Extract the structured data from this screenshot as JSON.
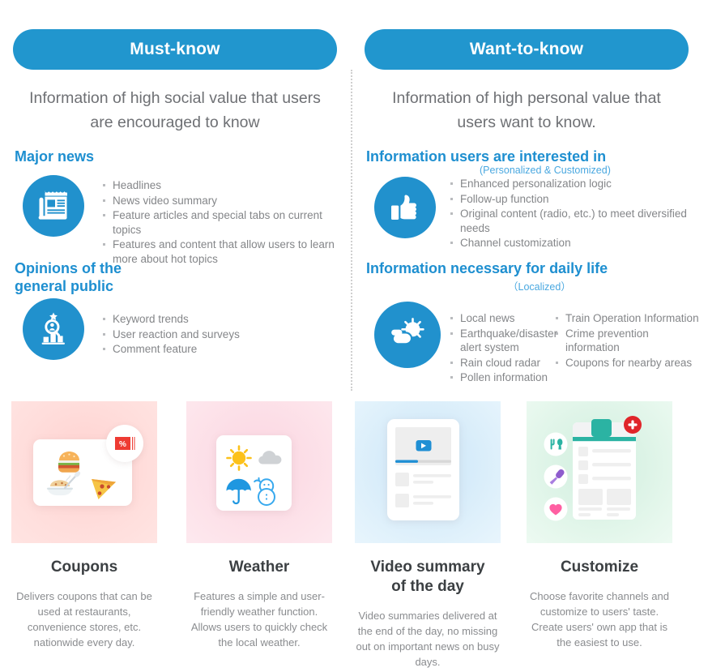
{
  "columns": [
    {
      "id": "must-know",
      "pill_label": "Must-know",
      "lede": "Information of high social value that users are encouraged to know",
      "sections": [
        {
          "title": "Major news",
          "subtitle": "",
          "icon": "newspaper-icon",
          "bullets": [
            "Headlines",
            "News video summary",
            "Feature articles and special tabs on current topics",
            "Features and content that allow users to learn more about hot topics"
          ]
        },
        {
          "title": "Opinions of the\ngeneral public",
          "subtitle": "",
          "icon": "survey-analytics-icon",
          "bullets": [
            "Keyword trends",
            "User reaction and surveys",
            "Comment feature"
          ]
        }
      ]
    },
    {
      "id": "want-to-know",
      "pill_label": "Want-to-know",
      "lede": "Information of high personal value that users want to know.",
      "sections": [
        {
          "title": "Information users are interested in",
          "subtitle": "(Personalized & Customized)",
          "icon": "thumbs-up-icon",
          "bullets": [
            "Enhanced personalization logic",
            "Follow-up function",
            "Original content (radio, etc.) to meet diversified needs",
            "Channel customization"
          ]
        },
        {
          "title": "Information necessary for daily life",
          "subtitle": "（Localized）",
          "icon": "sun-cloud-icon",
          "bullets_left": [
            "Local news",
            "Earthquake/disaster alert system",
            "Rain cloud radar",
            "Pollen information"
          ],
          "bullets_right": [
            "Train Operation Information",
            "Crime prevention information",
            "Coupons for nearby areas"
          ]
        }
      ]
    }
  ],
  "cards": [
    {
      "id": "coupons",
      "title": "Coupons",
      "description": "Delivers coupons that can be used at restaurants, convenience stores, etc. nationwide every day.",
      "art": "coupons-illustration"
    },
    {
      "id": "weather",
      "title": "Weather",
      "description": "Features a simple and user-friendly weather function. Allows users to quickly check the local weather.",
      "art": "weather-illustration"
    },
    {
      "id": "video-summary",
      "title": "Video summary\nof the day",
      "description": "Video summaries delivered at the end of the day, no missing out on important news on busy days.",
      "art": "video-summary-illustration"
    },
    {
      "id": "customize",
      "title": "Customize",
      "description": "Choose favorite channels and customize to users' taste. Create users' own app that is the easiest to use.",
      "art": "customize-illustration"
    }
  ],
  "colors": {
    "brand_blue": "#2196ce",
    "icon_blue": "#2191cd",
    "heading_blue": "#1e8fd0",
    "subtitle_blue": "#4aa8e0",
    "body_gray": "#848689",
    "lede_gray": "#6e7074",
    "card_title_gray": "#3c4043",
    "coupon_red": "#ee3b33",
    "customize_teal": "#2bb3a3",
    "customize_badge_red": "#e0252a"
  }
}
